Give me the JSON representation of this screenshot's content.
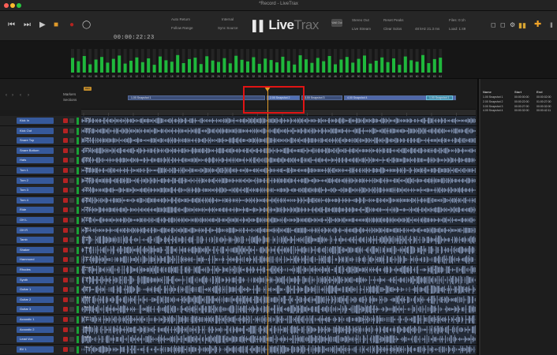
{
  "window": {
    "title": "*Record - LiveTrax",
    "traffic_light_colors": [
      "#fe5f57",
      "#febc2e",
      "#28c840"
    ]
  },
  "transport": {
    "timecode": "00:00:22:23",
    "auto_return_label": "Auto Return",
    "follow_range_label": "Follow Range",
    "internal_label": "Internal",
    "sync_source_label": "Sync Source",
    "wall_out_label": "Wall Out",
    "stereo_out_label": "Stereo Out",
    "live_stream_label": "Live Stream",
    "reset_peaks_label": "Reset Peaks",
    "clear_solos_label": "Clear Solos",
    "format_label": "48 kHz 21.3 ms",
    "files_label": "Files: 0:1h",
    "load_label": "Load: 1:49",
    "record_color": "#b3231f",
    "accent_color": "#e09a2a",
    "cue_color": "#f2a428"
  },
  "logo": {
    "bold": "Live",
    "light": "Trax"
  },
  "meters": {
    "channel_numbers": [
      "01",
      "02",
      "03",
      "04",
      "05",
      "06",
      "07",
      "08",
      "09",
      "10",
      "11",
      "12",
      "13",
      "14",
      "15",
      "16",
      "17",
      "18",
      "19",
      "20",
      "21",
      "22",
      "23",
      "24",
      "25",
      "26",
      "27",
      "28",
      "29",
      "30",
      "31",
      "32",
      "33",
      "34",
      "35",
      "36",
      "37",
      "38",
      "39",
      "40",
      "41",
      "42",
      "43",
      "44",
      "45",
      "46",
      "47",
      "48",
      "49",
      "50",
      "51",
      "52",
      "53",
      "54",
      "55",
      "56",
      "57",
      "58",
      "59",
      "60",
      "61",
      "62",
      "63",
      "64"
    ],
    "levels": [
      0.62,
      0.48,
      0.7,
      0.35,
      0.55,
      0.66,
      0.42,
      0.58,
      0.72,
      0.38,
      0.5,
      0.64,
      0.44,
      0.6,
      0.33,
      0.68,
      0.52,
      0.46,
      0.74,
      0.4,
      0.57,
      0.63,
      0.36,
      0.69,
      0.51,
      0.45,
      0.61,
      0.39,
      0.71,
      0.54,
      0.47,
      0.65,
      0.37,
      0.59,
      0.53,
      0.43,
      0.67,
      0.49,
      0.34,
      0.73,
      0.56,
      0.41,
      0.62,
      0.48,
      0.7,
      0.35,
      0.55,
      0.66,
      0.42,
      0.58,
      0.72,
      0.38,
      0.5,
      0.64,
      0.44,
      0.6,
      0.33,
      0.68,
      0.52,
      0.46,
      0.74,
      0.4,
      0.57,
      0.63
    ],
    "meter_color": "#1fb83c"
  },
  "markers_panel": {
    "markers_label": "Markers",
    "sections_label": "Sections",
    "marker_tag": "REC",
    "snapshots": [
      {
        "label": "1.00 Snapshot 1"
      },
      {
        "label": "2.00 Snapshot 2"
      },
      {
        "label": "3.00 Snapshot 3"
      },
      {
        "label": "4.00 Snapshot 4"
      },
      {
        "label": "1.00 Snapshot 1"
      }
    ]
  },
  "ruler": {
    "ticks": [
      "00:00:00:00",
      "00:00:01:00",
      "00:00:02:00",
      "00:00:03:00",
      "00:00:04:00",
      "00:00:05:00",
      "00:00:06:00",
      "00:00:07:00",
      "00:00:08:00",
      "00:00:09:00",
      "00:00:10:00",
      "00:00:11:00",
      "00:00:12:00",
      "00:00:13:00",
      "00:00:14:00",
      "00:00:15:00"
    ]
  },
  "tracks": [
    {
      "name": "Kick In"
    },
    {
      "name": "Kick Out"
    },
    {
      "name": "Snare Top"
    },
    {
      "name": "Snare Bottom"
    },
    {
      "name": "Hats"
    },
    {
      "name": "Tom 1"
    },
    {
      "name": "Tom 2"
    },
    {
      "name": "Tom 3"
    },
    {
      "name": "Tom 4"
    },
    {
      "name": "Ride"
    },
    {
      "name": "OH L"
    },
    {
      "name": "OH R"
    },
    {
      "name": "Tamb"
    },
    {
      "name": "Shaker"
    },
    {
      "name": "Hammond"
    },
    {
      "name": "Rhodes"
    },
    {
      "name": "Synth"
    },
    {
      "name": "Guitar 1"
    },
    {
      "name": "Guitar 2"
    },
    {
      "name": "Guitar 3"
    },
    {
      "name": "Acoustic 1"
    },
    {
      "name": "Acoustic 2"
    },
    {
      "name": "Lead Vox"
    },
    {
      "name": "BV 1"
    }
  ],
  "clip_label": "Take 2",
  "snapshot_panel": {
    "headers": {
      "name": "Name",
      "start": "Start",
      "end": "End"
    },
    "rows": [
      {
        "name": "1.00 Snapshot 1",
        "start": "00:00:00:00",
        "end": "00:00:02:00"
      },
      {
        "name": "2.00 Snapshot 2",
        "start": "00:00:22:00",
        "end": "01:00:27:00"
      },
      {
        "name": "3.00 Snapshot 3",
        "start": "00:00:27:00",
        "end": "00:00:32:00"
      },
      {
        "name": "4.00 Snapshot 4",
        "start": "00:00:32:00",
        "end": "00:00:42:11"
      }
    ]
  }
}
